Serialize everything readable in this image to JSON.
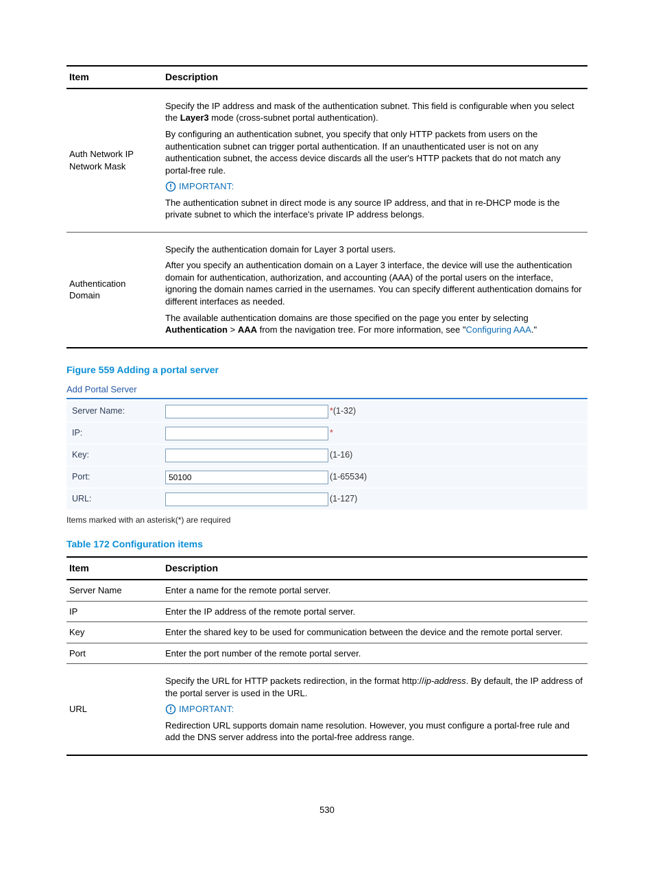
{
  "table1": {
    "head_item": "Item",
    "head_desc": "Description",
    "row0": {
      "item": "Auth Network IP Network Mask",
      "p1a": "Specify the IP address and mask of the authentication subnet. This field is configurable when you select the ",
      "p1b": "Layer3",
      "p1c": " mode (cross-subnet portal authentication).",
      "p2": "By configuring an authentication subnet, you specify that only HTTP packets from users on the authentication subnet can trigger portal authentication. If an unauthenticated user is not on any authentication subnet, the access device discards all the user's HTTP packets that do not match any portal-free rule.",
      "important": "IMPORTANT:",
      "p3": "The authentication subnet in direct mode is any source IP address, and that in re-DHCP mode is the private subnet to which the interface's private IP address belongs."
    },
    "row1": {
      "item": "Authentication Domain",
      "p1": "Specify the authentication domain for Layer 3 portal users.",
      "p2": "After you specify an authentication domain on a Layer 3 interface, the device will use the authentication domain for authentication, authorization, and accounting (AAA) of the portal users on the interface, ignoring the domain names carried in the usernames. You can specify different authentication domains for different interfaces as needed.",
      "p3a": "The available authentication domains are those specified on the page you enter by selecting ",
      "p3b": "Authentication",
      "p3c": " > ",
      "p3d": "AAA",
      "p3e": " from the navigation tree. For more information, see \"",
      "p3link": "Configuring AAA",
      "p3f": ".\""
    }
  },
  "figure": {
    "title": "Figure 559 Adding a portal server",
    "header": "Add Portal Server",
    "rows": {
      "server_name": {
        "label": "Server Name:",
        "value": "",
        "hint": "(1-32)",
        "required": true
      },
      "ip": {
        "label": "IP:",
        "value": "",
        "hint": "",
        "required": true
      },
      "key": {
        "label": "Key:",
        "value": "",
        "hint": "(1-16)",
        "required": false
      },
      "port": {
        "label": "Port:",
        "value": "50100",
        "hint": "(1-65534)",
        "required": false
      },
      "url": {
        "label": "URL:",
        "value": "",
        "hint": "(1-127)",
        "required": false
      }
    },
    "footnote": "Items marked with an asterisk(*) are required"
  },
  "table2": {
    "title": "Table 172 Configuration items",
    "head_item": "Item",
    "head_desc": "Description",
    "rows": {
      "r0": {
        "item": "Server Name",
        "desc": "Enter a name for the remote portal server."
      },
      "r1": {
        "item": "IP",
        "desc": "Enter the IP address of the remote portal server."
      },
      "r2": {
        "item": "Key",
        "desc": "Enter the shared key to be used for communication between the device and the remote portal server."
      },
      "r3": {
        "item": "Port",
        "desc": "Enter the port number of the remote portal server."
      },
      "r4": {
        "item": "URL",
        "p1a": "Specify the URL for HTTP packets redirection, in the format http://",
        "p1b": "ip-address",
        "p1c": ". By default, the IP address of the portal server is used in the URL.",
        "important": "IMPORTANT:",
        "p2": "Redirection URL supports domain name resolution. However, you must configure a portal-free rule and add the DNS server address into the portal-free address range."
      }
    }
  },
  "page_number": "530"
}
